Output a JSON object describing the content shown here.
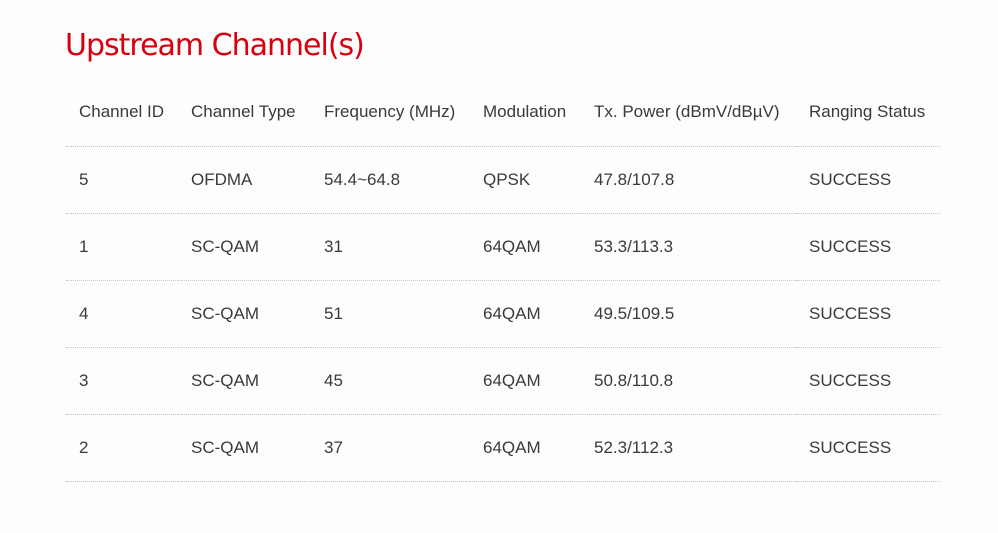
{
  "section": {
    "title": "Upstream Channel(s)"
  },
  "table": {
    "headers": [
      "Channel ID",
      "Channel Type",
      "Frequency (MHz)",
      "Modulation",
      "Tx. Power (dBmV/dBµV)",
      "Ranging Status"
    ],
    "rows": [
      [
        "5",
        "OFDMA",
        "54.4~64.8",
        "QPSK",
        "47.8/107.8",
        "SUCCESS"
      ],
      [
        "1",
        "SC-QAM",
        "31",
        "64QAM",
        "53.3/113.3",
        "SUCCESS"
      ],
      [
        "4",
        "SC-QAM",
        "51",
        "64QAM",
        "49.5/109.5",
        "SUCCESS"
      ],
      [
        "3",
        "SC-QAM",
        "45",
        "64QAM",
        "50.8/110.8",
        "SUCCESS"
      ],
      [
        "2",
        "SC-QAM",
        "37",
        "64QAM",
        "52.3/112.3",
        "SUCCESS"
      ]
    ]
  },
  "colors": {
    "title": "#d7000f",
    "text": "#3a3a3a",
    "divider": "#c4c4c4",
    "background": "#fdfdfd"
  }
}
